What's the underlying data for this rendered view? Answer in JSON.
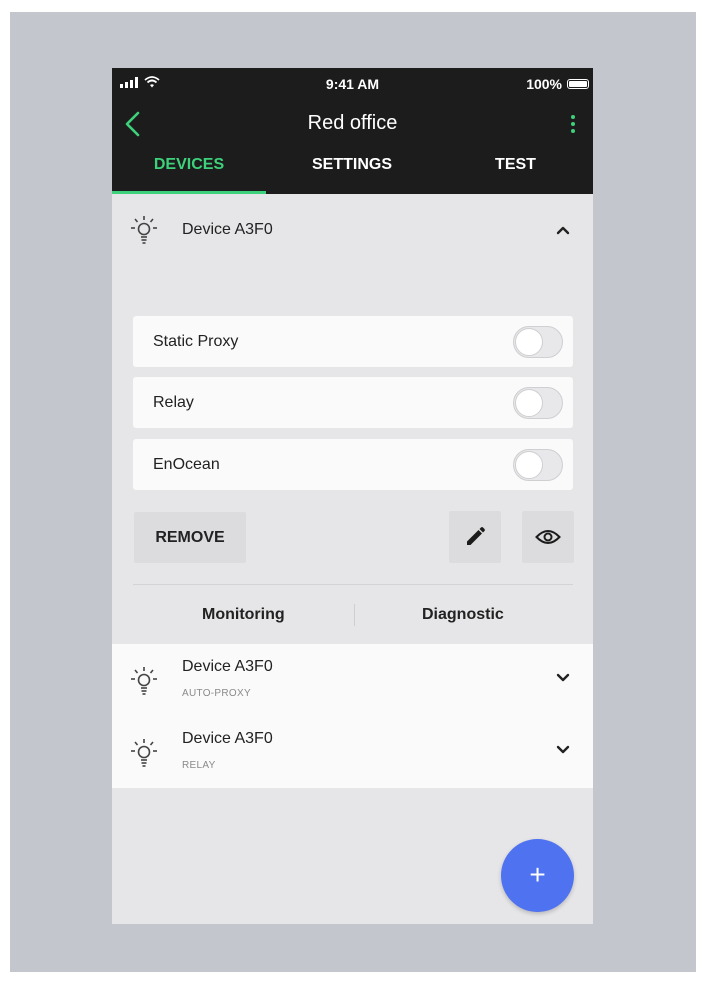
{
  "status_bar": {
    "time": "9:41 AM",
    "battery": "100%"
  },
  "nav": {
    "title": "Red office"
  },
  "tabs": [
    {
      "label": "DEVICES",
      "active": true
    },
    {
      "label": "SETTINGS",
      "active": false
    },
    {
      "label": "TEST",
      "active": false
    }
  ],
  "expanded_device": {
    "name": "Device A3F0",
    "options": [
      {
        "label": "Static Proxy",
        "enabled": false
      },
      {
        "label": "Relay",
        "enabled": false
      },
      {
        "label": "EnOcean",
        "enabled": false
      }
    ],
    "remove_label": "REMOVE",
    "sub_tabs": [
      "Monitoring",
      "Diagnostic"
    ]
  },
  "devices": [
    {
      "name": "Device A3F0",
      "type": "AUTO-PROXY"
    },
    {
      "name": "Device A3F0",
      "type": "RELAY"
    }
  ],
  "fab_label": "+",
  "colors": {
    "accent": "#3ed17b",
    "fab": "#4f72f0",
    "bar": "#1c1c1c"
  },
  "icons": [
    "back-arrow-icon",
    "more-vert-icon",
    "bulb-icon",
    "chevron-up-icon",
    "chevron-down-icon",
    "edit-icon",
    "eye-icon",
    "plus-icon"
  ]
}
